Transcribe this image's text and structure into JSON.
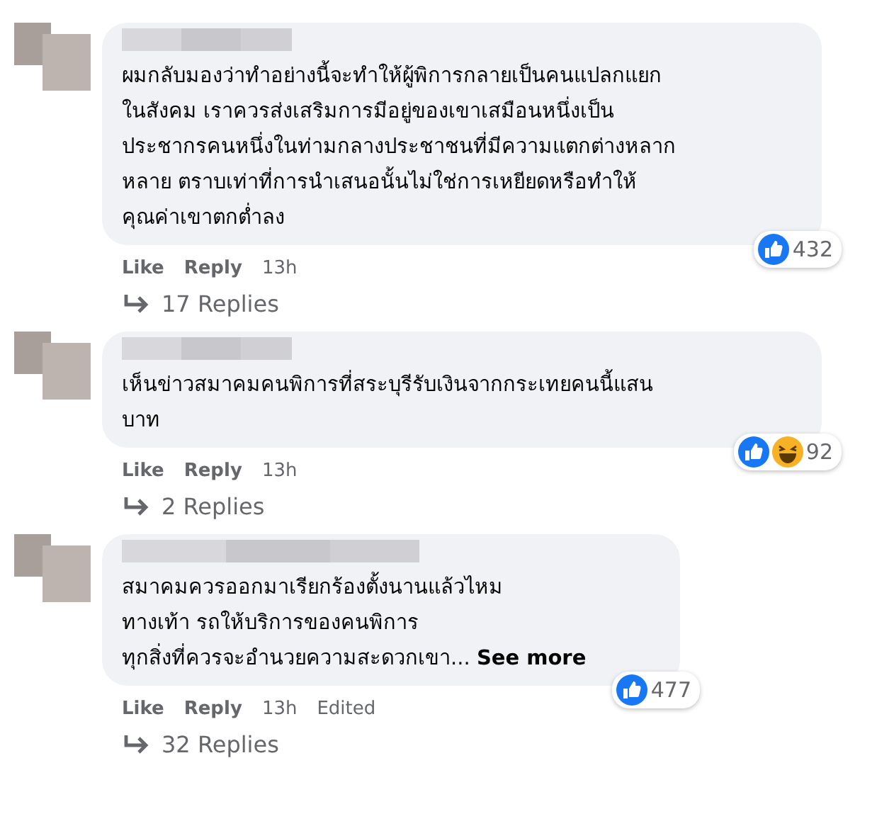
{
  "comments": [
    {
      "lines": [
        "ผมกลับมองว่าทำอย่างนี้จะทำให้ผู้พิการกลายเป็นคนแปลกแยก",
        "ในสังคม เราควรส่งเสริมการมีอยู่ของเขาเสมือนหนึ่งเป็น",
        "ประชากรคนหนึ่งในท่ามกลางประชาชนที่มีความแตกต่างหลาก",
        "หลาย ตราบเท่าที่การนำเสนอนั้นไม่ใช่การเหยียดหรือทำให้",
        "คุณค่าเขาตกต่ำลง"
      ],
      "actions": [
        "Like",
        "Reply"
      ],
      "time": "13h",
      "reactions": [
        {
          "kind": "like"
        }
      ],
      "reaction_count": "432",
      "replies": "17 Replies",
      "wide": true
    },
    {
      "lines": [
        "เห็นข่าวสมาคมคนพิการที่สระบุรีรับเงินจากกระเทยคนนี้แสน",
        "บาท"
      ],
      "actions": [
        "Like",
        "Reply"
      ],
      "time": "13h",
      "reactions": [
        {
          "kind": "like"
        },
        {
          "kind": "haha"
        }
      ],
      "reaction_count": "92",
      "replies": "2 Replies",
      "wide": true
    },
    {
      "lines": [
        "สมาคมควรออกมาเรียกร้องตั้งนานแล้วไหม",
        "ทางเท้า รถให้บริการของคนพิการ",
        "ทุกสิ่งที่ควรจะอำนวยความสะดวกเขา..."
      ],
      "see_more": "See more",
      "actions": [
        "Like",
        "Reply"
      ],
      "time": "13h",
      "edited": "Edited",
      "reactions": [
        {
          "kind": "like"
        }
      ],
      "reaction_count": "477",
      "replies": "32 Replies",
      "wide": false
    }
  ]
}
